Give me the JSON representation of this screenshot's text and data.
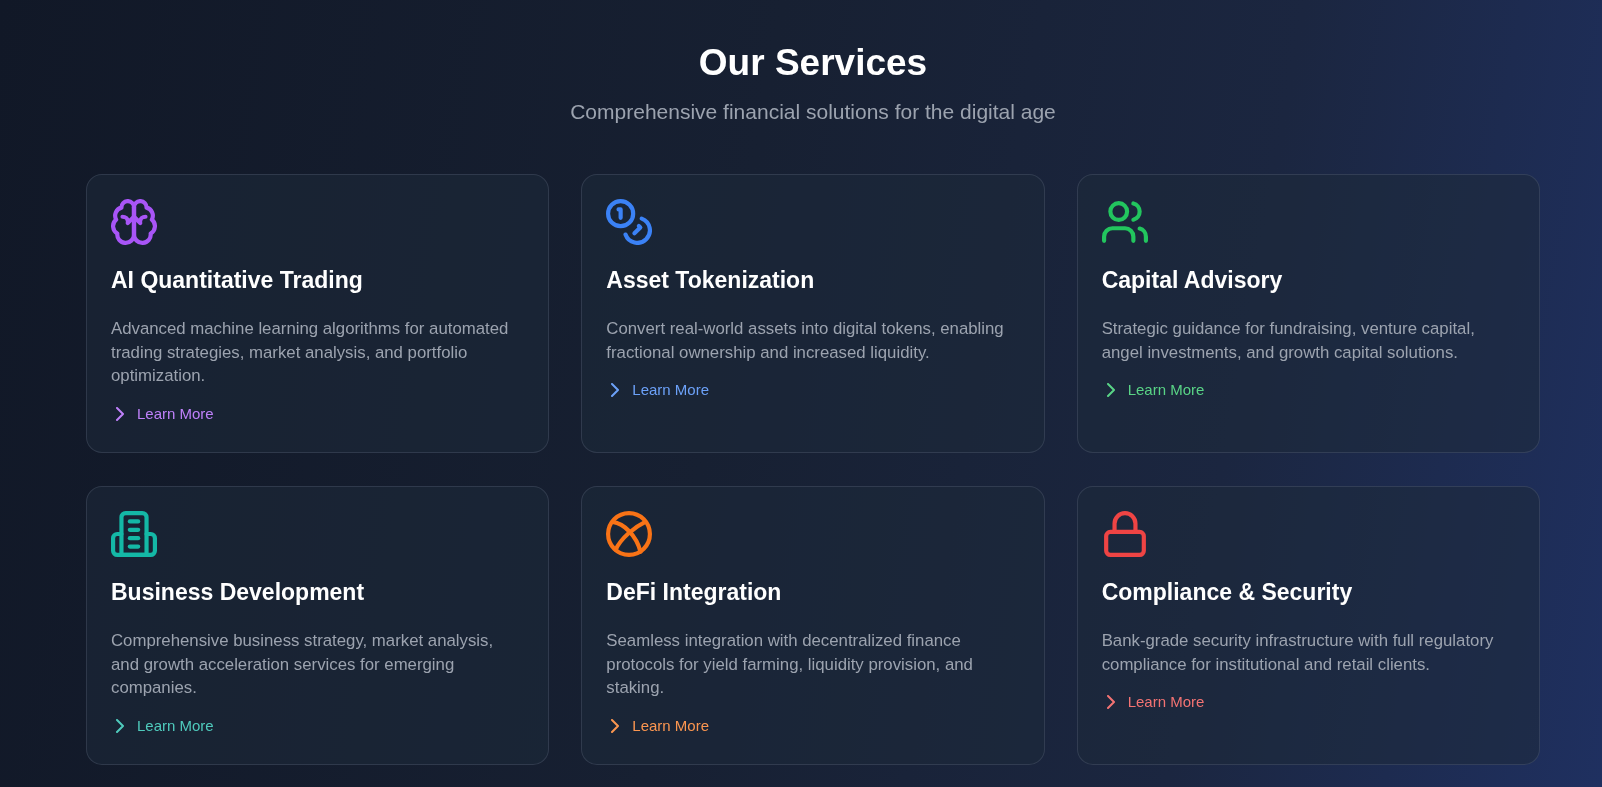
{
  "header": {
    "title": "Our Services",
    "subtitle": "Comprehensive financial solutions for the digital age"
  },
  "services": [
    {
      "title": "AI Quantitative Trading",
      "description": "Advanced machine learning algorithms for automated trading strategies, market analysis, and portfolio optimization.",
      "link": "Learn More",
      "color": "#a855f7"
    },
    {
      "title": "Asset Tokenization",
      "description": "Convert real-world assets into digital tokens, enabling fractional ownership and increased liquidity.",
      "link": "Learn More",
      "color": "#3b82f6"
    },
    {
      "title": "Capital Advisory",
      "description": "Strategic guidance for fundraising, venture capital, angel investments, and growth capital solutions.",
      "link": "Learn More",
      "color": "#22c55e"
    },
    {
      "title": "Business Development",
      "description": "Comprehensive business strategy, market analysis, and growth acceleration services for emerging companies.",
      "link": "Learn More",
      "color": "#14b8a6"
    },
    {
      "title": "DeFi Integration",
      "description": "Seamless integration with decentralized finance protocols for yield farming, liquidity provision, and staking.",
      "link": "Learn More",
      "color": "#f97316"
    },
    {
      "title": "Compliance & Security",
      "description": "Bank-grade security infrastructure with full regulatory compliance for institutional and retail clients.",
      "link": "Learn More",
      "color": "#ef4444"
    }
  ]
}
